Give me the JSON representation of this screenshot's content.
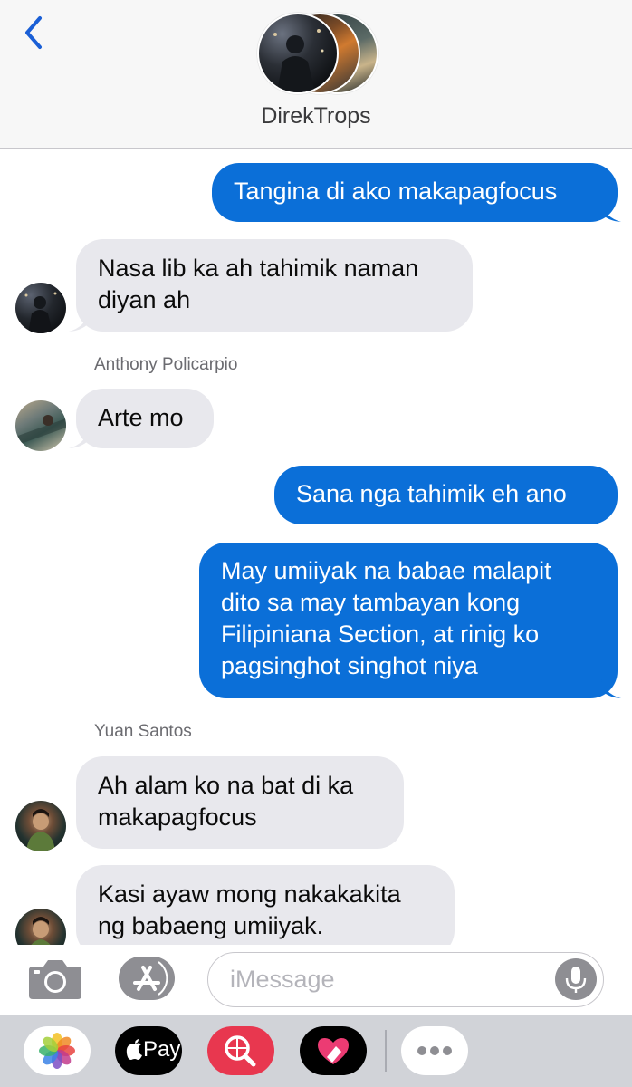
{
  "header": {
    "title": "DirekTrops",
    "back_icon": "chevron-left-icon"
  },
  "messages": [
    {
      "direction": "outgoing",
      "text": "Tangina di ako makapagfocus"
    },
    {
      "direction": "incoming",
      "text": "Nasa lib ka ah tahimik naman diyan ah"
    },
    {
      "direction": "incoming",
      "sender": "Anthony Policarpio",
      "text": "Arte mo"
    },
    {
      "direction": "outgoing",
      "text": "Sana nga tahimik eh ano"
    },
    {
      "direction": "outgoing",
      "text": "May umiiyak na babae malapit dito sa may tambayan kong Filipiniana Section, at rinig ko pagsinghot singhot niya"
    },
    {
      "direction": "incoming",
      "sender": "Yuan Santos",
      "text": "Ah alam ko na bat di ka makapagfocus"
    },
    {
      "direction": "incoming",
      "text": "Kasi ayaw mong nakakakita ng babaeng umiiyak."
    }
  ],
  "composer": {
    "placeholder": "iMessage",
    "camera_icon": "camera-icon",
    "apps_icon": "app-store-icon",
    "mic_icon": "microphone-icon"
  },
  "app_tray": {
    "apps": [
      "photos-icon",
      "apple-pay-icon",
      "web-search-icon",
      "digital-touch-icon",
      "more-icon"
    ],
    "apple_pay_label": "Pay"
  },
  "colors": {
    "outgoing_bubble": "#0b6fd8",
    "incoming_bubble": "#e8e8ed",
    "header_bg": "#f7f7f7",
    "tray_bg": "#d1d3d8",
    "back_chevron": "#1a5fd6"
  }
}
